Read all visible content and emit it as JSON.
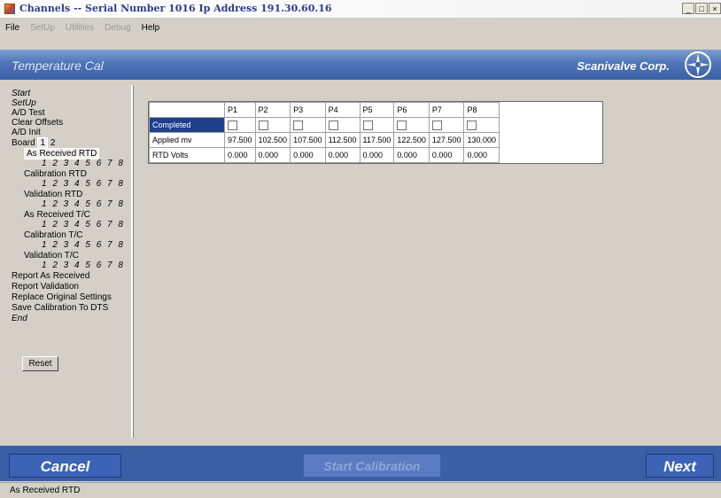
{
  "window": {
    "title": "Channels -- Serial Number 1016  Ip Address 191.30.60.16",
    "buttons": {
      "minimize": "_",
      "maximize": "□",
      "close": "×"
    }
  },
  "menu": {
    "items": [
      {
        "label": "File",
        "enabled": true
      },
      {
        "label": "SetUp",
        "enabled": false
      },
      {
        "label": "Utilities",
        "enabled": false
      },
      {
        "label": "Debug",
        "enabled": false
      },
      {
        "label": "Help",
        "enabled": true
      }
    ]
  },
  "header": {
    "title": "Temperature Cal",
    "brand": "Scanivalve Corp.",
    "brand_icon": "scanivalve-logo-icon"
  },
  "nav": {
    "start": "Start",
    "setup": "SetUp",
    "ad_test": "A/D Test",
    "clear_offsets": "Clear Offsets",
    "ad_init": "A/D Init",
    "board_label": "Board",
    "board_1": "1",
    "board_2": "2",
    "as_received_rtd": "As Received RTD",
    "channels": "1 2 3 4 5 6 7 8",
    "calibration_rtd": "Calibration RTD",
    "validation_rtd": "Validation RTD",
    "as_received_tc": "As Received T/C",
    "calibration_tc": "Calibration T/C",
    "validation_tc": "Validation T/C",
    "report_as_received": "Report As Received",
    "report_validation": "Report Validation",
    "replace_original": "Replace Original Settings",
    "save_calibration": "Save Calibration To DTS",
    "end": "End",
    "reset": "Reset"
  },
  "grid": {
    "columns": [
      "P1",
      "P2",
      "P3",
      "P4",
      "P5",
      "P6",
      "P7",
      "P8"
    ],
    "rows": {
      "completed": {
        "label": "Completed",
        "checked": [
          false,
          false,
          false,
          false,
          false,
          false,
          false,
          false
        ]
      },
      "applied_mv": {
        "label": "Applied mv",
        "values": [
          "97.500",
          "102.500",
          "107.500",
          "112.500",
          "117.500",
          "122.500",
          "127.500",
          "130.000"
        ]
      },
      "rtd_volts": {
        "label": "RTD Volts",
        "values": [
          "0.000",
          "0.000",
          "0.000",
          "0.000",
          "0.000",
          "0.000",
          "0.000",
          "0.000"
        ]
      }
    }
  },
  "actions": {
    "cancel": "Cancel",
    "start_calibration": "Start Calibration",
    "next": "Next"
  },
  "status": {
    "text": "As Received RTD"
  },
  "colors": {
    "header_blue": "#4f74b8",
    "selection": "#1f3f8f",
    "title_text": "#2b3d8f"
  }
}
